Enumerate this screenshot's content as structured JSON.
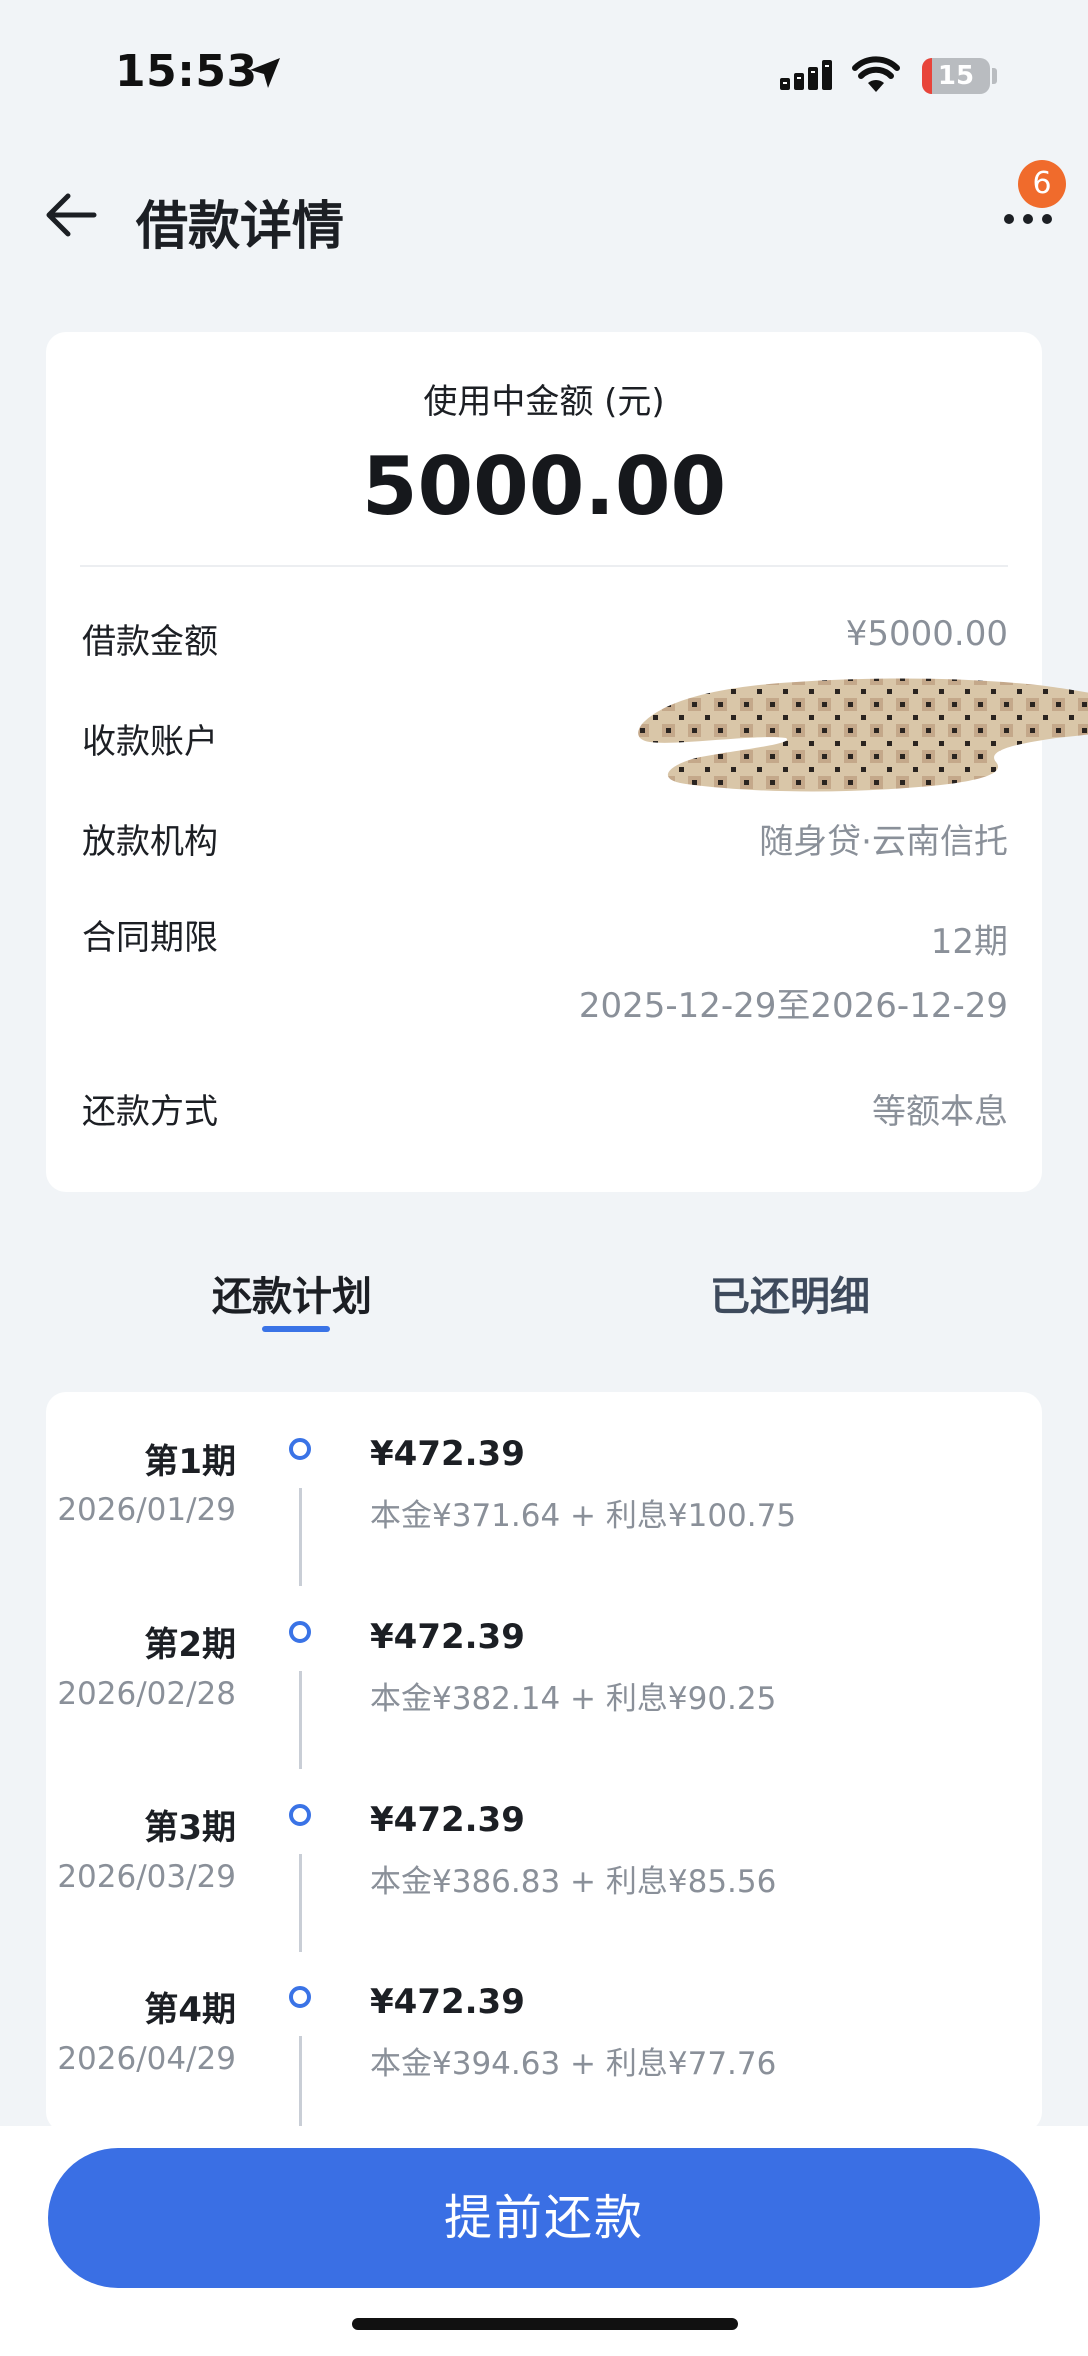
{
  "status_bar": {
    "time": "15:53",
    "battery": "15",
    "battery_level": 0.15,
    "icons": [
      "location-arrow-icon",
      "signal-icon",
      "wifi-icon",
      "battery-charging-icon"
    ]
  },
  "header": {
    "title": "借款详情",
    "badge_count": "6",
    "icons": [
      "back-arrow-icon",
      "more-icon"
    ]
  },
  "summary": {
    "amount_caption": "使用中金额 (元)",
    "amount_value": "5000.00",
    "rows": [
      {
        "label": "借款金额",
        "value": "¥5000.00"
      },
      {
        "label": "收款账户",
        "value": ""
      },
      {
        "label": "放款机构",
        "value": "随身贷·云南信托"
      },
      {
        "label": "合同期限",
        "value": "12期",
        "value2": "2025-12-29至2026-12-29"
      },
      {
        "label": "还款方式",
        "value": "等额本息"
      }
    ]
  },
  "tabs": [
    {
      "label": "还款计划",
      "active": true
    },
    {
      "label": "已还明细",
      "active": false
    }
  ],
  "plan": [
    {
      "period": "第1期",
      "date": "2026/01/29",
      "amount": "¥472.39",
      "breakdown": "本金¥371.64 + 利息¥100.75"
    },
    {
      "period": "第2期",
      "date": "2026/02/28",
      "amount": "¥472.39",
      "breakdown": "本金¥382.14 + 利息¥90.25"
    },
    {
      "period": "第3期",
      "date": "2026/03/29",
      "amount": "¥472.39",
      "breakdown": "本金¥386.83 + 利息¥85.56"
    },
    {
      "period": "第4期",
      "date": "2026/04/29",
      "amount": "¥472.39",
      "breakdown": "本金¥394.63 + 利息¥77.76"
    }
  ],
  "footer": {
    "prepay_label": "提前还款"
  },
  "colors": {
    "accent": "#3a6fe4",
    "badge": "#f06b2c",
    "background": "#f1f4f7"
  }
}
